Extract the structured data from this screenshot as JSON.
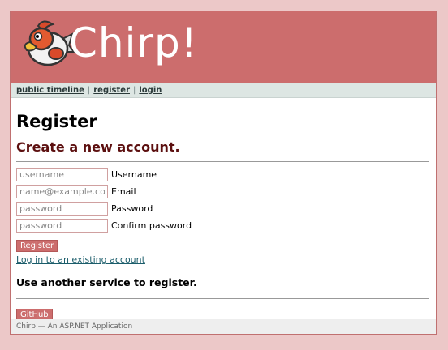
{
  "header": {
    "brand": "Chirp!",
    "logo_icon": "bird-logo-icon"
  },
  "nav": {
    "items": [
      "public timeline",
      "register",
      "login"
    ],
    "separator": "|"
  },
  "main": {
    "title": "Register",
    "subtitle": "Create a new account.",
    "fields": [
      {
        "placeholder": "username",
        "value": "",
        "label": "Username"
      },
      {
        "placeholder": "name@example.com",
        "value": "",
        "label": "Email"
      },
      {
        "placeholder": "password",
        "value": "",
        "label": "Password"
      },
      {
        "placeholder": "password",
        "value": "",
        "label": "Confirm password"
      }
    ],
    "register_button": "Register",
    "login_link": "Log in to an existing account",
    "external_heading": "Use another service to register.",
    "github_button": "GitHub"
  },
  "footer": {
    "text": "Chirp — An ASP.NET Application"
  },
  "colors": {
    "accent": "#cc6d6d",
    "background": "#ecc8c8",
    "nav": "#dde6e3",
    "heading": "#5c0f0f"
  }
}
